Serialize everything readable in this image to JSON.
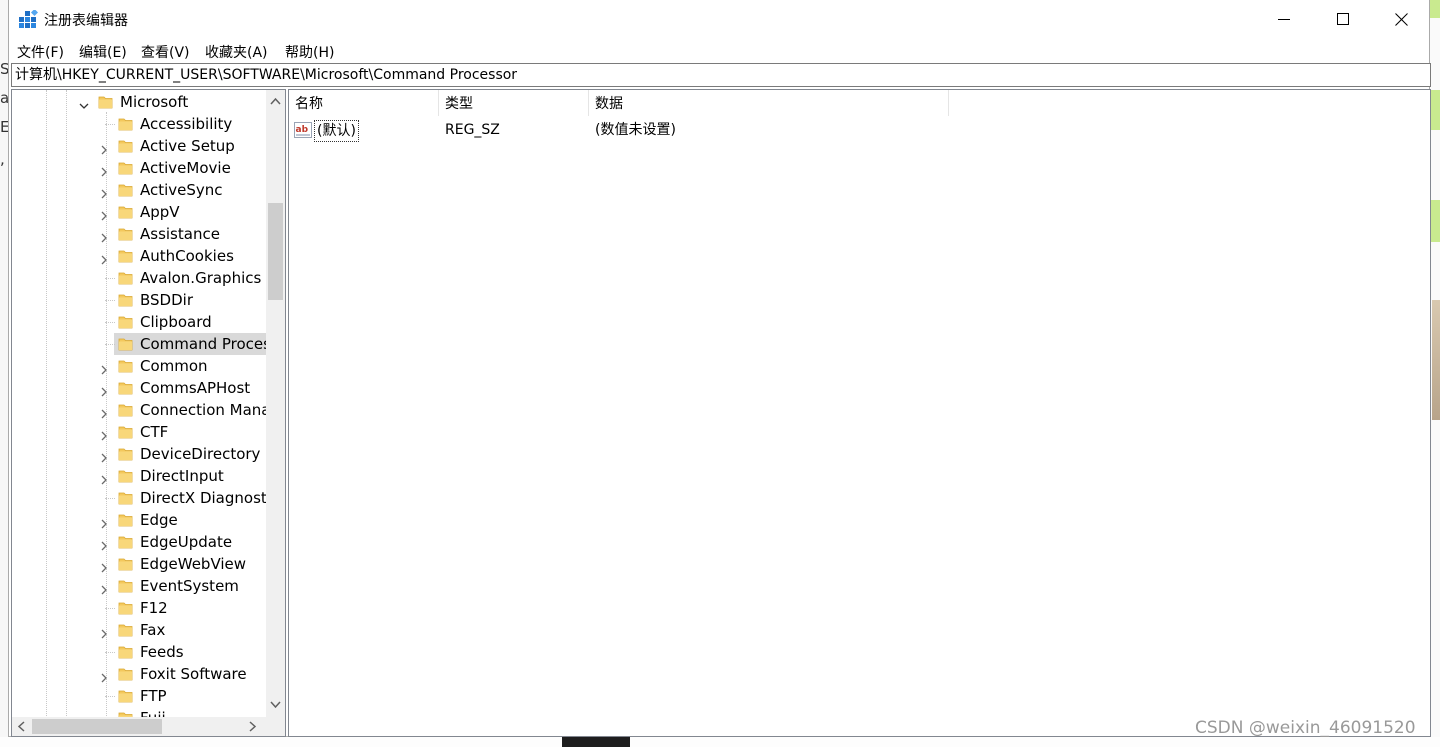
{
  "window": {
    "title": "注册表编辑器",
    "minimize_label": "minimize",
    "maximize_label": "maximize",
    "close_label": "close"
  },
  "menu": [
    {
      "label": "文件(F)"
    },
    {
      "label": "编辑(E)"
    },
    {
      "label": "查看(V)"
    },
    {
      "label": "收藏夹(A)"
    },
    {
      "label": "帮助(H)"
    }
  ],
  "address": {
    "path": "计算机\\HKEY_CURRENT_USER\\SOFTWARE\\Microsoft\\Command Processor"
  },
  "tree": {
    "parent": {
      "label": "Microsoft",
      "expanded": true
    },
    "children": [
      {
        "label": "Accessibility",
        "expandable": false
      },
      {
        "label": "Active Setup",
        "expandable": true
      },
      {
        "label": "ActiveMovie",
        "expandable": true
      },
      {
        "label": "ActiveSync",
        "expandable": true
      },
      {
        "label": "AppV",
        "expandable": true
      },
      {
        "label": "Assistance",
        "expandable": true
      },
      {
        "label": "AuthCookies",
        "expandable": true
      },
      {
        "label": "Avalon.Graphics",
        "expandable": false
      },
      {
        "label": "BSDDir",
        "expandable": false
      },
      {
        "label": "Clipboard",
        "expandable": false
      },
      {
        "label": "Command Processor",
        "expandable": false,
        "selected": true
      },
      {
        "label": "Common",
        "expandable": true
      },
      {
        "label": "CommsAPHost",
        "expandable": true
      },
      {
        "label": "Connection Manager",
        "expandable": true
      },
      {
        "label": "CTF",
        "expandable": true
      },
      {
        "label": "DeviceDirectory",
        "expandable": true
      },
      {
        "label": "DirectInput",
        "expandable": true
      },
      {
        "label": "DirectX Diagnostic Tool",
        "expandable": false
      },
      {
        "label": "Edge",
        "expandable": true
      },
      {
        "label": "EdgeUpdate",
        "expandable": true
      },
      {
        "label": "EdgeWebView",
        "expandable": true
      },
      {
        "label": "EventSystem",
        "expandable": true
      },
      {
        "label": "F12",
        "expandable": false
      },
      {
        "label": "Fax",
        "expandable": true
      },
      {
        "label": "Feeds",
        "expandable": false
      },
      {
        "label": "Foxit Software",
        "expandable": true
      },
      {
        "label": "FTP",
        "expandable": false
      },
      {
        "label": "Fuji",
        "expandable": false
      }
    ]
  },
  "list": {
    "columns": [
      {
        "label": "名称"
      },
      {
        "label": "类型"
      },
      {
        "label": "数据"
      }
    ],
    "rows": [
      {
        "name": "(默认)",
        "type": "REG_SZ",
        "data": "(数值未设置)",
        "icon": "string-value-icon"
      }
    ]
  },
  "watermark": "CSDN @weixin_46091520",
  "colors": {
    "selection": "#d9d9d9",
    "folder": "#f4c95d",
    "accent_green": "#c9ea8f"
  }
}
